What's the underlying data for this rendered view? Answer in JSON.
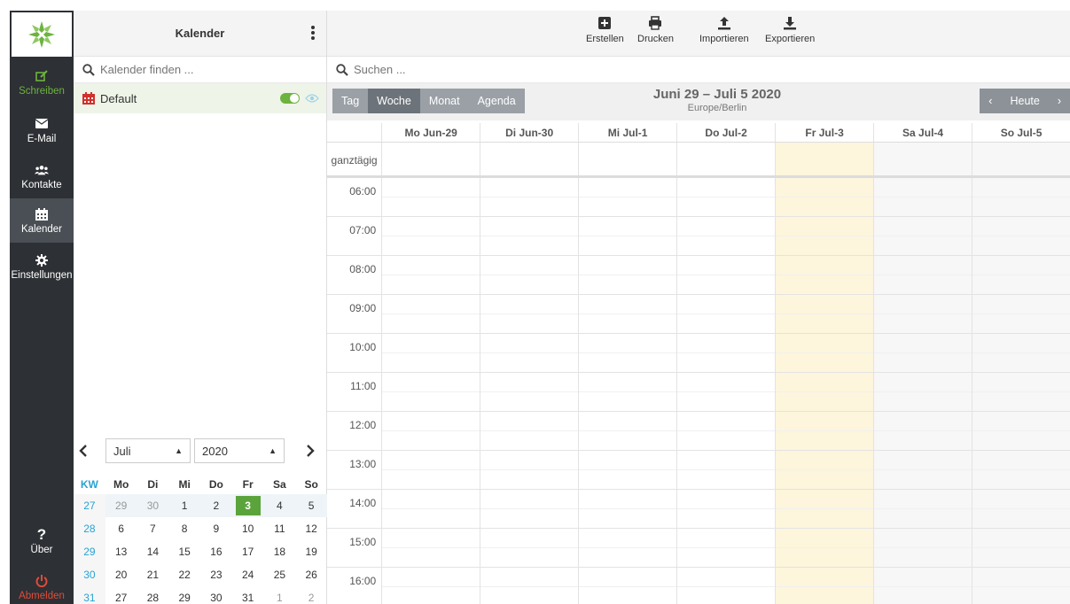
{
  "nav": {
    "items": [
      {
        "label": "Schreiben",
        "icon": "compose-icon"
      },
      {
        "label": "E-Mail",
        "icon": "envelope-icon"
      },
      {
        "label": "Kontakte",
        "icon": "contacts-icon"
      },
      {
        "label": "Kalender",
        "icon": "calendar-icon"
      },
      {
        "label": "Einstellungen",
        "icon": "gear-icon"
      },
      {
        "label": "Über",
        "icon": "question-icon"
      },
      {
        "label": "Abmelden",
        "icon": "power-icon"
      }
    ]
  },
  "list": {
    "title": "Kalender",
    "search_placeholder": "Kalender finden ...",
    "calendars": [
      {
        "name": "Default",
        "enabled": true
      }
    ]
  },
  "mini": {
    "month": "Juli",
    "year": "2020",
    "headers": [
      "KW",
      "Mo",
      "Di",
      "Mi",
      "Do",
      "Fr",
      "Sa",
      "So"
    ],
    "weeks": [
      [
        "27",
        "29",
        "30",
        "1",
        "2",
        "3",
        "4",
        "5"
      ],
      [
        "28",
        "6",
        "7",
        "8",
        "9",
        "10",
        "11",
        "12"
      ],
      [
        "29",
        "13",
        "14",
        "15",
        "16",
        "17",
        "18",
        "19"
      ],
      [
        "30",
        "20",
        "21",
        "22",
        "23",
        "24",
        "25",
        "26"
      ],
      [
        "31",
        "27",
        "28",
        "29",
        "30",
        "31",
        "1",
        "2"
      ]
    ]
  },
  "toolbar": {
    "create": "Erstellen",
    "print": "Drucken",
    "import": "Importieren",
    "export": "Exportieren"
  },
  "main": {
    "search_placeholder": "Suchen ...",
    "views": [
      "Tag",
      "Woche",
      "Monat",
      "Agenda"
    ],
    "active_view": "Woche",
    "range": "Juni 29 – Juli 5 2020",
    "timezone": "Europe/Berlin",
    "today_label": "Heute",
    "days": [
      "Mo Jun-29",
      "Di Jun-30",
      "Mi Jul-1",
      "Do Jul-2",
      "Fr Jul-3",
      "Sa Jul-4",
      "So Jul-5"
    ],
    "allday_label": "ganztägig",
    "hours": [
      "06:00",
      "07:00",
      "08:00",
      "09:00",
      "10:00",
      "11:00",
      "12:00",
      "13:00",
      "14:00",
      "15:00",
      "16:00"
    ]
  }
}
